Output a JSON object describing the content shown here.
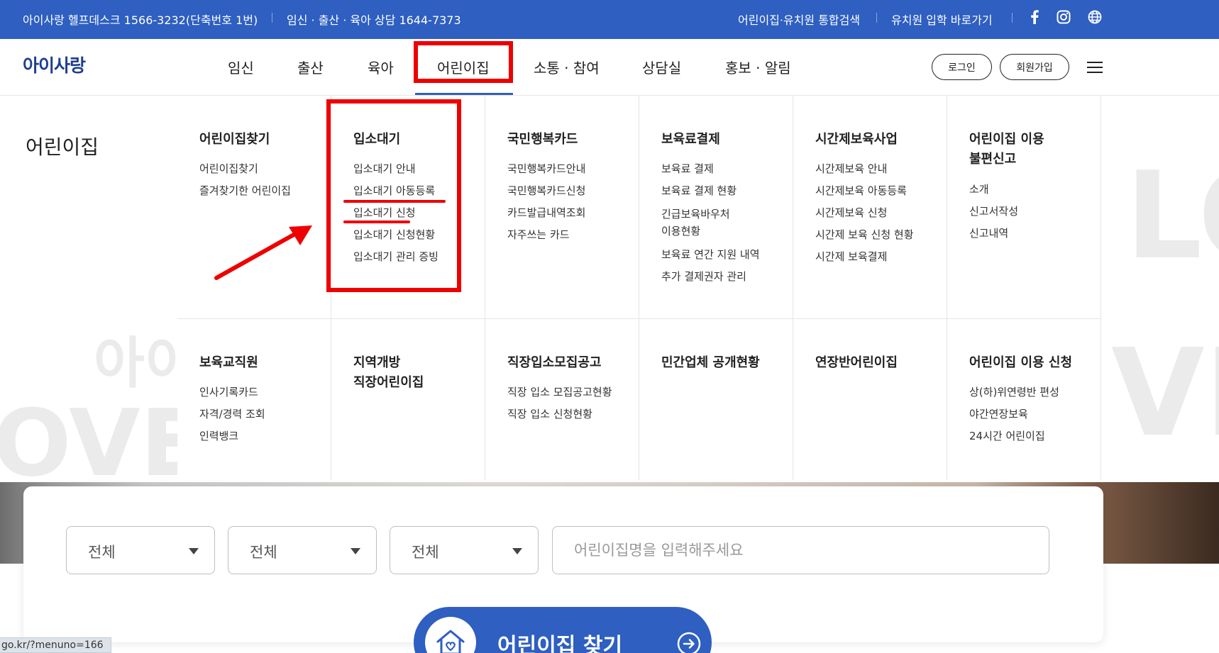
{
  "topbar": {
    "helpdesk": "아이사랑 헬프데스크 1566-3232(단축번호 1번)",
    "counsel": "임신 · 출산 · 육아 상담 1644-7373",
    "integrated_search": "어린이집·유치원 통합검색",
    "kindergarten_link": "유치원 입학 바로가기",
    "icons": [
      "facebook-icon",
      "instagram-icon",
      "globe-icon"
    ],
    "bg_color": "#2e5fc1"
  },
  "header": {
    "logo": "아이사랑",
    "nav": [
      "임신",
      "출산",
      "육아",
      "어린이집",
      "소통 · 참여",
      "상담실",
      "홍보 · 알림"
    ],
    "active_nav": "어린이집",
    "login": "로그인",
    "signup": "회원가입",
    "menu_icon": "hamburger-icon"
  },
  "megamenu": {
    "section_title": "어린이집",
    "row1": [
      {
        "title": "어린이집찾기",
        "links": [
          "어린이집찾기",
          "즐겨찾기한 어린이집"
        ]
      },
      {
        "title": "입소대기",
        "links": [
          "입소대기 안내",
          "입소대기 아동등록",
          "입소대기 신청",
          "입소대기 신청현황",
          "입소대기 관리 증빙"
        ]
      },
      {
        "title": "국민행복카드",
        "links": [
          "국민행복카드안내",
          "국민행복카드신청",
          "카드발급내역조회",
          "자주쓰는 카드"
        ]
      },
      {
        "title": "보육료결제",
        "links": [
          "보육료 결제",
          "보육료 결제 현황",
          "긴급보육바우처\n이용현황",
          "보육료 연간 지원 내역",
          "추가 결제권자 관리"
        ]
      },
      {
        "title": "시간제보육사업",
        "links": [
          "시간제보육 안내",
          "시간제보육 아동등록",
          "시간제보육 신청",
          "시간제 보육 신청 현황",
          "시간제 보육결제"
        ]
      },
      {
        "title": "어린이집 이용\n불편신고",
        "links": [
          "소개",
          "신고서작성",
          "신고내역"
        ]
      }
    ],
    "row2": [
      {
        "title": "보육교직원",
        "links": [
          "인사기록카드",
          "자격/경력 조회",
          "인력뱅크"
        ]
      },
      {
        "title": "지역개방\n직장어린이집",
        "links": []
      },
      {
        "title": "직장입소모집공고",
        "links": [
          "직장 입소 모집공고현황",
          "직장 입소 신청현황"
        ]
      },
      {
        "title": "민간업체 공개현황",
        "links": []
      },
      {
        "title": "연장반어린이집",
        "links": []
      },
      {
        "title": "어린이집 이용 신청",
        "links": [
          "상(하)위연령반 편성",
          "야간연장보육",
          "24시간 어린이집"
        ]
      }
    ]
  },
  "background_text": {
    "left_top": "아이",
    "left_bottom": "OVE",
    "right_top": "LO",
    "right_bottom": "VE"
  },
  "search": {
    "select1": "전체",
    "select2": "전체",
    "select3": "전체",
    "placeholder": "어린이집명을 입력해주세요",
    "find_button": "어린이집 찾기"
  },
  "status_url": "go.kr/?menuno=166",
  "colors": {
    "brand_blue": "#2e5fc1",
    "annotation_red": "#ee0000"
  }
}
